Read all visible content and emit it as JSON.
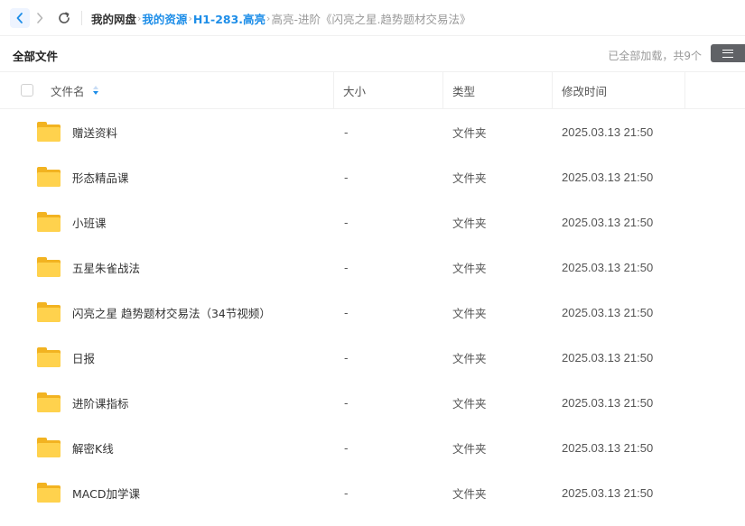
{
  "nav": {
    "back_icon": "chevron-left-icon",
    "forward_icon": "chevron-right-icon",
    "refresh_icon": "refresh-icon",
    "accent": "#1e8ee8"
  },
  "breadcrumb": {
    "root": "我的网盘",
    "level1": "我的资源",
    "level2": "H1-283.高亮",
    "current": "高亮-进阶《闪亮之星.趋势题材交易法》",
    "separator": "›"
  },
  "header": {
    "title": "全部文件",
    "status": "已全部加载，共9个",
    "view_icon": "list-view-icon"
  },
  "columns": {
    "name": "文件名",
    "size": "大小",
    "type": "类型",
    "modified": "修改时间"
  },
  "files": [
    {
      "name": "赠送资料",
      "size": "-",
      "type": "文件夹",
      "modified": "2025.03.13 21:50"
    },
    {
      "name": "形态精品课",
      "size": "-",
      "type": "文件夹",
      "modified": "2025.03.13 21:50"
    },
    {
      "name": "小班课",
      "size": "-",
      "type": "文件夹",
      "modified": "2025.03.13 21:50"
    },
    {
      "name": "五星朱雀战法",
      "size": "-",
      "type": "文件夹",
      "modified": "2025.03.13 21:50"
    },
    {
      "name": "闪亮之星 趋势题材交易法（34节视频）",
      "size": "-",
      "type": "文件夹",
      "modified": "2025.03.13 21:50"
    },
    {
      "name": "日报",
      "size": "-",
      "type": "文件夹",
      "modified": "2025.03.13 21:50"
    },
    {
      "name": "进阶课指标",
      "size": "-",
      "type": "文件夹",
      "modified": "2025.03.13 21:50"
    },
    {
      "name": "解密K线",
      "size": "-",
      "type": "文件夹",
      "modified": "2025.03.13 21:50"
    },
    {
      "name": "MACD加学课",
      "size": "-",
      "type": "文件夹",
      "modified": "2025.03.13 21:50"
    }
  ]
}
